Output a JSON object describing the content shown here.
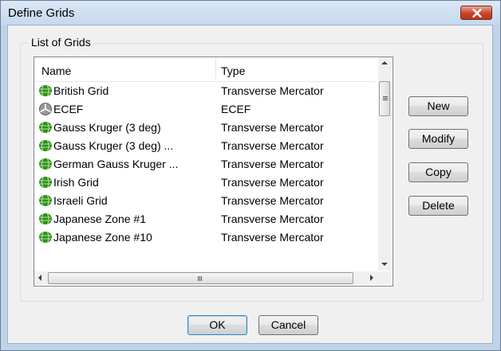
{
  "window": {
    "title": "Define Grids"
  },
  "group": {
    "label": "List of Grids"
  },
  "list": {
    "columns": [
      {
        "label": "Name"
      },
      {
        "label": "Type"
      }
    ],
    "rows": [
      {
        "name": "British Grid",
        "type": "Transverse Mercator",
        "icon": "grid-globe-icon"
      },
      {
        "name": "ECEF",
        "type": "ECEF",
        "icon": "ecef-axes-icon"
      },
      {
        "name": "Gauss Kruger (3 deg)",
        "type": "Transverse Mercator",
        "icon": "grid-globe-icon"
      },
      {
        "name": "Gauss Kruger (3 deg) ...",
        "type": "Transverse Mercator",
        "icon": "grid-globe-icon"
      },
      {
        "name": "German Gauss Kruger ...",
        "type": "Transverse Mercator",
        "icon": "grid-globe-icon"
      },
      {
        "name": "Irish Grid",
        "type": "Transverse Mercator",
        "icon": "grid-globe-icon"
      },
      {
        "name": "Israeli Grid",
        "type": "Transverse Mercator",
        "icon": "grid-globe-icon"
      },
      {
        "name": "Japanese Zone #1",
        "type": "Transverse Mercator",
        "icon": "grid-globe-icon"
      },
      {
        "name": "Japanese Zone #10",
        "type": "Transverse Mercator",
        "icon": "grid-globe-icon"
      }
    ]
  },
  "buttons": {
    "new": "New",
    "modify": "Modify",
    "copy": "Copy",
    "delete": "Delete",
    "ok": "OK",
    "cancel": "Cancel"
  },
  "colors": {
    "grid_icon_green": "#2f8f1e",
    "close_red": "#c8452c",
    "default_button_border": "#3c7fb1"
  }
}
